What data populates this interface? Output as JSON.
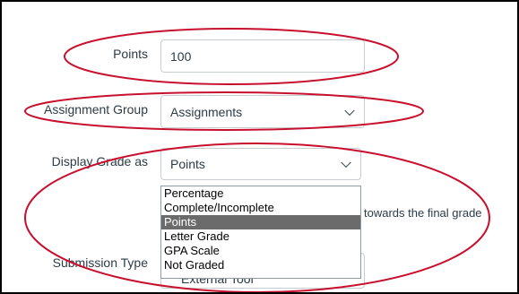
{
  "points": {
    "label": "Points",
    "value": "100"
  },
  "assignment_group": {
    "label": "Assignment Group",
    "selected": "Assignments"
  },
  "display_grade": {
    "label": "Display Grade as",
    "selected": "Points",
    "options": [
      "Percentage",
      "Complete/Incomplete",
      "Points",
      "Letter Grade",
      "GPA Scale",
      "Not Graded"
    ],
    "highlighted": "Points"
  },
  "final_grade_text": "towards the final grade",
  "submission_type": {
    "label": "Submission Type",
    "selected": "External Tool"
  },
  "colors": {
    "annotation": "#c8102e",
    "highlight": "#6b6b6b",
    "border": "#c7cdd1"
  }
}
